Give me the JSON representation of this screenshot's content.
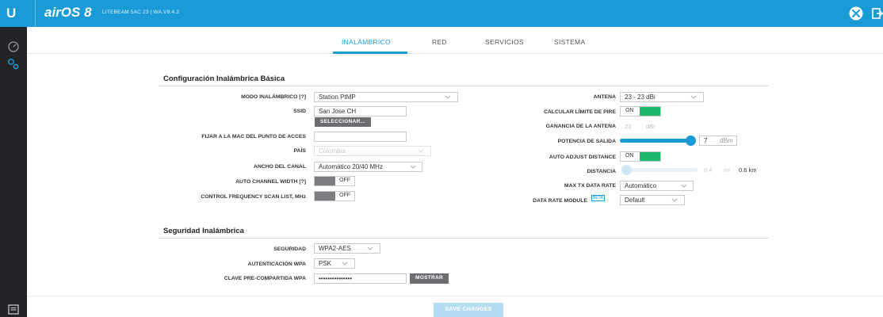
{
  "header": {
    "logo": "U",
    "brand": "airOS 8",
    "device": "LITEBEAM 5AC 23 | WA.V8.4.2",
    "icons": [
      "tools-icon",
      "logout-icon"
    ]
  },
  "sidebar": {
    "icons": [
      "dashboard-icon",
      "settings-icon",
      "notes-icon"
    ]
  },
  "tabs": [
    {
      "label": "INALÁMBRICO",
      "active": true
    },
    {
      "label": "RED",
      "active": false
    },
    {
      "label": "SERVICIOS",
      "active": false
    },
    {
      "label": "SISTEMA",
      "active": false
    }
  ],
  "basic": {
    "title": "Configuración Inalámbrica Básica",
    "mode_label": "MODO INALÁMBRICO [?]",
    "mode_value": "Station PtMP",
    "ssid_label": "SSID",
    "ssid_value": "San Jose CH",
    "select_button": "SELECCIONAR...",
    "mac_label": "FIJAR A LA MAC DEL PUNTO DE ACCES",
    "mac_value": "",
    "country_label": "PAÍS",
    "country_value": "Colombia",
    "channel_width_label": "ANCHO DEL CANAL",
    "channel_width_value": "Automático 20/40 MHz",
    "auto_channel_label": "AUTO CHANNEL WIDTH [?]",
    "auto_channel_value": "OFF",
    "scan_list_label": "CONTROL FREQUENCY SCAN LIST, MHz",
    "scan_list_value": "OFF",
    "antenna_label": "ANTENA",
    "antenna_value": "23 - 23 dBi",
    "pire_label": "CALCULAR LÍMITE DE PIRE",
    "pire_value": "ON",
    "gain_label": "GANANCIA DE LA ANTENA",
    "gain_value": "23",
    "gain_unit": "dBi",
    "power_label": "POTENCIA DE SALIDA",
    "power_value": "7",
    "power_unit": "dBm",
    "auto_distance_label": "AUTO ADJUST DISTANCE",
    "auto_distance_value": "ON",
    "distance_label": "DISTANCIA",
    "distance_value": "0.4",
    "distance_unit": "mi",
    "distance_km": "0.6 km",
    "max_tx_label": "MAX TX DATA RATE",
    "max_tx_value": "Automático",
    "data_rate_label": "DATA RATE MODULE",
    "beta_badge": "BETA",
    "data_rate_value": "Default"
  },
  "security": {
    "title": "Seguridad Inalámbrica",
    "security_label": "SEGURIDAD",
    "security_value": "WPA2-AES",
    "auth_label": "AUTENTICACIÓN WPA",
    "auth_value": "PSK",
    "key_label": "CLAVE PRE-COMPARTIDA WPA",
    "key_value": "•••••••••••••••",
    "show_button": "MOSTRAR"
  },
  "footer": {
    "save_button": "SAVE CHANGES"
  },
  "colors": {
    "accent": "#1a9ad7",
    "sidebar": "#232428",
    "toggle_on": "#1db86a",
    "toggle_off": "#7a7c80"
  },
  "sliders": {
    "power_fraction": 0.95,
    "distance_fraction": 0.0
  }
}
